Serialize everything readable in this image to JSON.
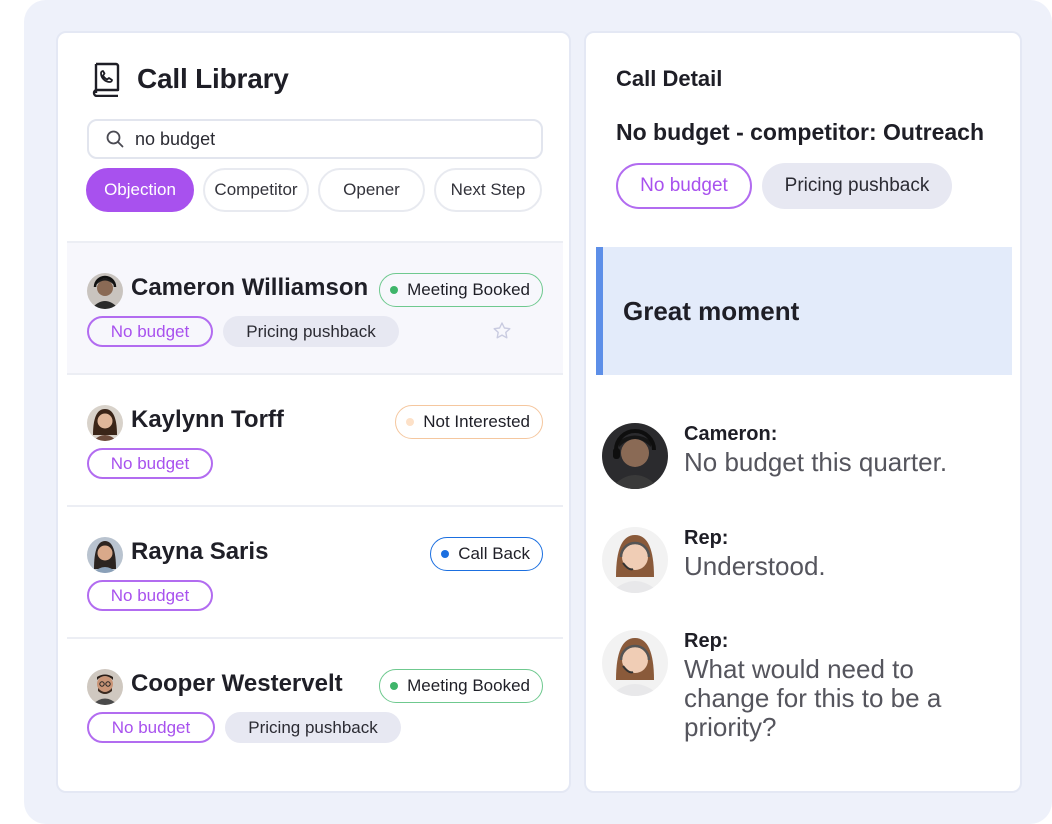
{
  "library": {
    "title": "Call Library",
    "search_value": "no budget",
    "filters": [
      {
        "label": "Objection",
        "active": true
      },
      {
        "label": "Competitor",
        "active": false
      },
      {
        "label": "Opener",
        "active": false
      },
      {
        "label": "Next Step",
        "active": false
      }
    ],
    "calls": [
      {
        "name": "Cameron Williamson",
        "status": "Meeting Booked",
        "status_color": "#3fb56a",
        "tags": [
          "No budget",
          "Pricing pushback"
        ],
        "selected": true
      },
      {
        "name": "Kaylynn Torff",
        "status": "Not Interested",
        "status_color": "#f2b37a",
        "tags": [
          "No budget"
        ],
        "selected": false
      },
      {
        "name": "Rayna Saris",
        "status": "Call Back",
        "status_color": "#1b6fe0",
        "tags": [
          "No budget"
        ],
        "selected": false
      },
      {
        "name": "Cooper Westervelt",
        "status": "Meeting Booked",
        "status_color": "#3fb56a",
        "tags": [
          "No budget",
          "Pricing pushback"
        ],
        "selected": false
      }
    ]
  },
  "detail": {
    "label": "Call Detail",
    "title": "No budget - competitor: Outreach",
    "tags": [
      "No budget",
      "Pricing pushback"
    ],
    "moment": "Great moment",
    "transcript": [
      {
        "speaker": "Cameron:",
        "text": "No budget this quarter."
      },
      {
        "speaker": "Rep:",
        "text": "Understood."
      },
      {
        "speaker": "Rep:",
        "text": "What would need to change for this to be a priority?"
      }
    ]
  },
  "colors": {
    "accent_purple": "#a851ee",
    "moment_bg": "#e3ebfa",
    "moment_bar": "#5d8fe8",
    "page_bg": "#eef1fa"
  },
  "icons": [
    "phone-book-icon",
    "search-icon",
    "star-icon"
  ]
}
